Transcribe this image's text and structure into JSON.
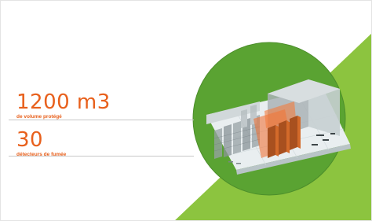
{
  "colors": {
    "accent": "#e8601c",
    "green_light": "#8cc43f",
    "green_circle": "#5aa332",
    "rule": "#c8c8c8"
  },
  "stats": [
    {
      "value": "1200 m3",
      "label": "de volume protégé"
    },
    {
      "value": "30",
      "label": "détecteurs de fumée"
    }
  ],
  "illustration": {
    "icon": "server-room-3d-illustration"
  }
}
